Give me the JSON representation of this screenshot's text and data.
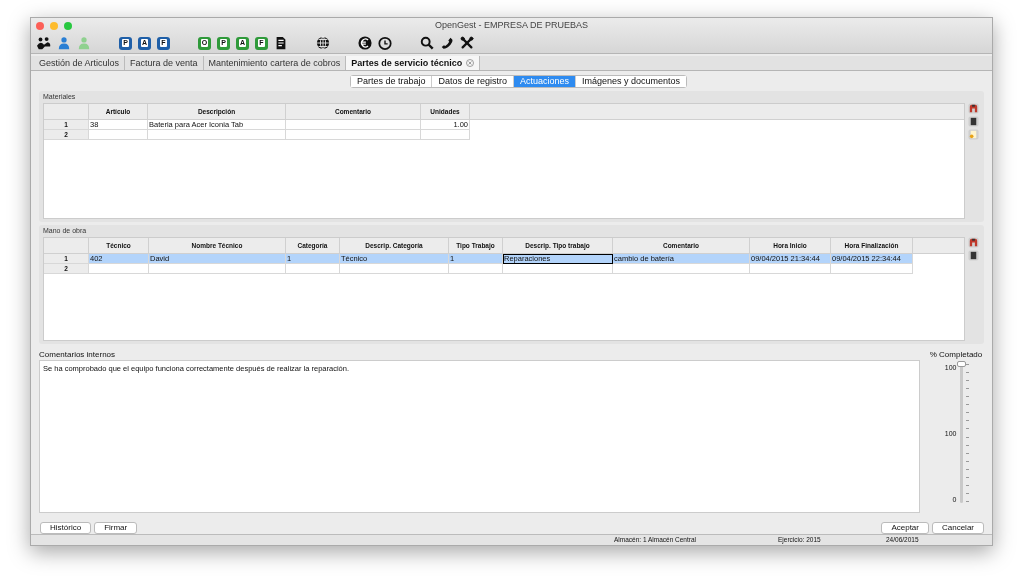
{
  "window": {
    "title": "OpenGest - EMPRESA DE PRUEBAS"
  },
  "toolbar": {
    "groups": [
      [
        {
          "kind": "people"
        },
        {
          "kind": "person",
          "color": "#2a7fd4"
        },
        {
          "kind": "person",
          "color": "#8fd18f"
        }
      ],
      [
        {
          "kind": "letter",
          "label": "P",
          "color": "#1f5fa8"
        },
        {
          "kind": "letter",
          "label": "A",
          "color": "#1f5fa8"
        },
        {
          "kind": "letter",
          "label": "F",
          "color": "#1f5fa8"
        }
      ],
      [
        {
          "kind": "letter",
          "label": "O",
          "color": "#2f9a3a"
        },
        {
          "kind": "letter",
          "label": "P",
          "color": "#2f9a3a"
        },
        {
          "kind": "letter",
          "label": "A",
          "color": "#2f9a3a"
        },
        {
          "kind": "letter",
          "label": "F",
          "color": "#2f9a3a"
        },
        {
          "kind": "doc"
        }
      ],
      [
        {
          "kind": "globe"
        }
      ],
      [
        {
          "kind": "euro"
        },
        {
          "kind": "clock"
        }
      ],
      [
        {
          "kind": "search"
        },
        {
          "kind": "phone"
        },
        {
          "kind": "tools"
        }
      ]
    ]
  },
  "tabs": [
    {
      "label": "Gestión de Articulos",
      "selected": false,
      "closable": false
    },
    {
      "label": "Factura de venta",
      "selected": false,
      "closable": false
    },
    {
      "label": "Mantenimiento cartera de cobros",
      "selected": false,
      "closable": false
    },
    {
      "label": "Partes de servicio técnico",
      "selected": true,
      "closable": true
    }
  ],
  "subtabs": [
    {
      "label": "Partes de trabajo",
      "selected": false
    },
    {
      "label": "Datos de registro",
      "selected": false
    },
    {
      "label": "Actuaciones",
      "selected": true
    },
    {
      "label": "Imágenes y documentos",
      "selected": false
    }
  ],
  "materiales": {
    "title": "Materiales",
    "side_icons": [
      {
        "kind": "binoculars"
      },
      {
        "kind": "page"
      },
      {
        "kind": "note"
      }
    ],
    "columns": [
      {
        "label": "Artículo",
        "kind": "text"
      },
      {
        "label": "Descripción",
        "kind": "text"
      },
      {
        "label": "Comentario",
        "kind": "text"
      },
      {
        "label": "Unidades",
        "kind": "number"
      }
    ],
    "rows": [
      {
        "number": "1",
        "selected": false,
        "cells": [
          {
            "text": "38",
            "focused": false
          },
          {
            "text": "Bateria para Acer Iconia Tab",
            "focused": false
          },
          {
            "text": "",
            "focused": false
          },
          {
            "text": "1.00",
            "focused": false
          }
        ]
      },
      {
        "number": "2",
        "selected": false,
        "cells": []
      }
    ]
  },
  "mano_de_obra": {
    "title": "Mano de obra",
    "side_icons": [
      {
        "kind": "binoculars"
      },
      {
        "kind": "page"
      }
    ],
    "columns": [
      {
        "label": "Técnico",
        "kind": "text"
      },
      {
        "label": "Nombre Técnico",
        "kind": "text"
      },
      {
        "label": "Categoría",
        "kind": "text"
      },
      {
        "label": "Descrip. Categoría",
        "kind": "text"
      },
      {
        "label": "Tipo Trabajo",
        "kind": "text"
      },
      {
        "label": "Descrip. Tipo trabajo",
        "kind": "text"
      },
      {
        "label": "Comentario",
        "kind": "text"
      },
      {
        "label": "Hora Inicio",
        "kind": "text"
      },
      {
        "label": "Hora Finalización",
        "kind": "text"
      }
    ],
    "rows": [
      {
        "number": "1",
        "selected": true,
        "cells": [
          {
            "text": "402",
            "focused": false
          },
          {
            "text": "David",
            "focused": false
          },
          {
            "text": "1",
            "focused": false
          },
          {
            "text": "Técnico",
            "focused": false
          },
          {
            "text": "1",
            "focused": false
          },
          {
            "text": "Reparaciones",
            "focused": true
          },
          {
            "text": "cambio de batería",
            "focused": false
          },
          {
            "text": "09/04/2015 21:34:44",
            "focused": false
          },
          {
            "text": "09/04/2015 22:34:44",
            "focused": false
          }
        ]
      },
      {
        "number": "2",
        "selected": false,
        "cells": []
      }
    ]
  },
  "comments": {
    "label": "Comentarios internos",
    "value": "Se ha comprobado que el equipo funciona correctamente después de realizar la reparación."
  },
  "progress": {
    "label": "% Completado",
    "level": 1,
    "scale": [
      "100",
      "100",
      "0"
    ]
  },
  "left_buttons": [
    "Histórico",
    "Firmar"
  ],
  "right_buttons": [
    "Aceptar",
    "Cancelar"
  ],
  "status_bar": [
    "Almacén: 1 Almacén Central",
    "Ejercicio: 2015",
    "24/06/2015"
  ]
}
